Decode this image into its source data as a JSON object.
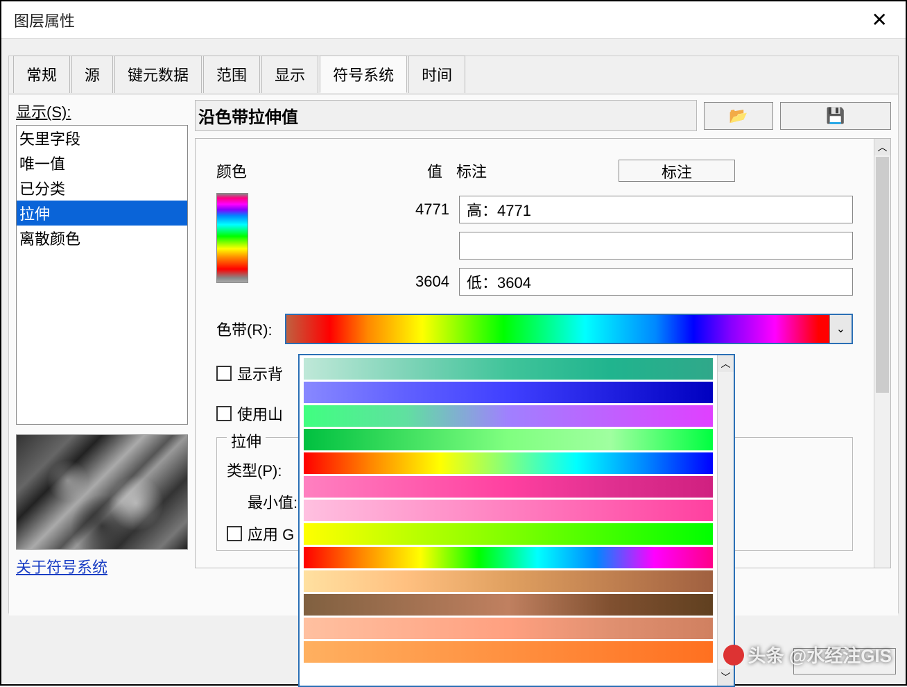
{
  "window": {
    "title": "图层属性"
  },
  "tabs": [
    "常规",
    "源",
    "键元数据",
    "范围",
    "显示",
    "符号系统",
    "时间"
  ],
  "active_tab": "符号系统",
  "display_label": "显示(S):",
  "display_items": [
    "矢里字段",
    "唯一值",
    "已分类",
    "拉伸",
    "离散颜色"
  ],
  "selected_item": "拉伸",
  "about_link": "关于符号系统",
  "heading": "沿色带拉伸值",
  "labels": {
    "color": "颜色",
    "value": "值",
    "annotation": "标注",
    "annotation_btn": "标注",
    "ramp": "色带(R):",
    "show_bg": "显示背",
    "use_hill": "使用山",
    "stretch": "拉伸",
    "type": "类型(P):",
    "minval": "最小值:",
    "apply_g": "应用 G"
  },
  "values": {
    "high_num": "4771",
    "high_label": "高：4771",
    "mid_label": "",
    "low_num": "3604",
    "low_label": "低：3604"
  },
  "ramps": [
    "linear-gradient(to right,#bfe8d8,#7fd4b8,#40c49a,#20b48e,#30a88a)",
    "linear-gradient(to right,#8888ff,#6060ff,#4040ff,#2020e0,#0000c0)",
    "linear-gradient(to right,#40ff80,#60e0a0,#a080ff,#c060ff,#e040ff)",
    "linear-gradient(to right,#00c040,#40e060,#80ff80,#a0ffa0,#00ff40)",
    "linear-gradient(to right,#ff0000,#ff8800,#ffff00,#80ff80,#00ffff,#0088ff,#0000ff)",
    "linear-gradient(to right,#ff80c0,#ff60b0,#ff40a0,#e03090,#d02080)",
    "linear-gradient(to right,#ffc0e0,#ffa0d0,#ff80c0,#ff60b0,#ff40a0)",
    "linear-gradient(to right,#ffff00,#c0ff00,#80ff00,#40ff00,#00ff00)",
    "linear-gradient(to right,#ff0000,#ff8800,#ffff00,#00ff00,#00ffff,#0088ff,#ff00ff,#ff0088)",
    "linear-gradient(to right,#ffe0a0,#ffc080,#e0a060,#c08050,#a06040)",
    "linear-gradient(to right,#806040,#a07050,#c08060,#805030,#604020)",
    "linear-gradient(to right,#ffc0a0,#ffb090,#ffa080,#e09070,#d08060)",
    "linear-gradient(to right,#ffb060,#ffa050,#ff9040,#ff8030,#ff7020)"
  ],
  "watermark": "头条 @水经注GIS"
}
